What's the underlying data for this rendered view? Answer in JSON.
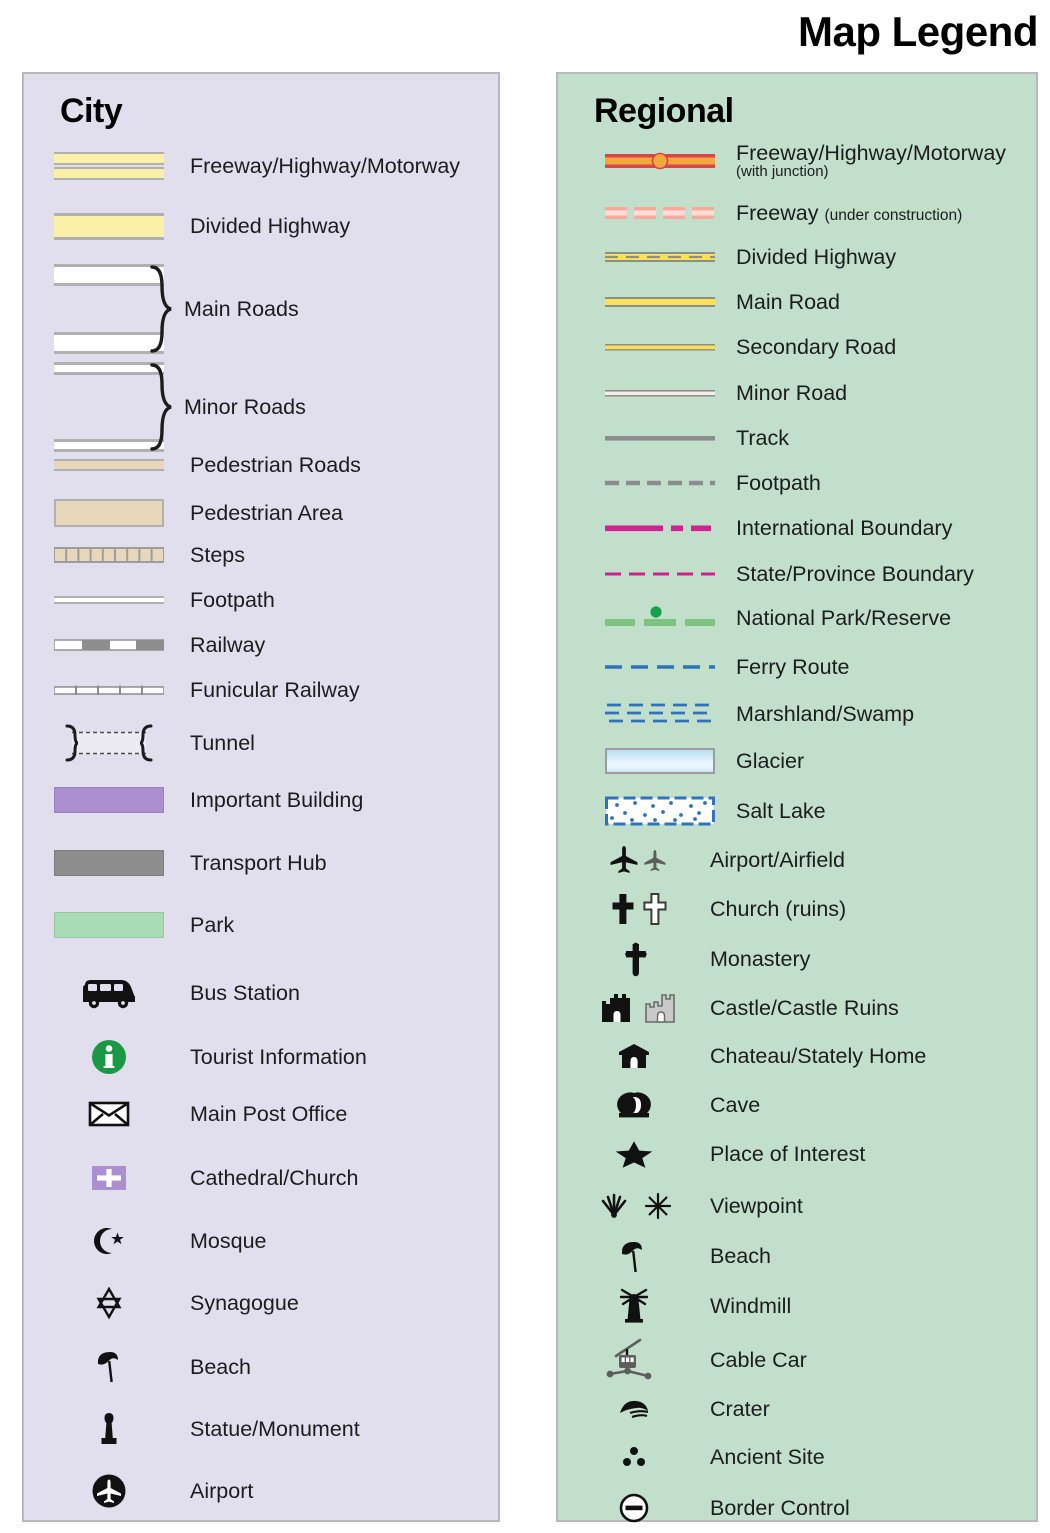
{
  "title": "Map Legend",
  "colors": {
    "city_panel_bg": "#e1deee",
    "regional_panel_bg": "#c2dfcb",
    "panel_border": "#b9b9bd",
    "highway_yellow": "#fbf0a8",
    "road_gray": "#b0b0b0",
    "pedestrian_tan": "#e8d8bb",
    "important_building_purple": "#ab8fd0",
    "transport_hub_gray": "#8d8d8d",
    "park_green": "#a9dcb4",
    "tourist_info_green": "#1a9944",
    "freeway_red": "#d9454a",
    "freeway_orange": "#f2a93c",
    "under_construction_pink": "#f8a99b",
    "regional_yellow": "#fbe255",
    "track_gray": "#8d8d8d",
    "boundary_magenta": "#cf2190",
    "national_park_green": "#7cc47f",
    "national_park_dot": "#16a04a",
    "ferry_blue": "#2f73bd",
    "glacier_blue": "#cfe6f7"
  },
  "city": {
    "heading": "City",
    "items": [
      {
        "label": "Freeway/Highway/Motorway",
        "icon": "freeway-band-symbol"
      },
      {
        "label": "Divided Highway",
        "icon": "divided-highway-symbol"
      },
      {
        "label": "Main Roads",
        "icon": "main-roads-symbol"
      },
      {
        "label": "Minor Roads",
        "icon": "minor-roads-symbol"
      },
      {
        "label": "Pedestrian Roads",
        "icon": "pedestrian-roads-symbol"
      },
      {
        "label": "Pedestrian Area",
        "icon": "pedestrian-area-symbol"
      },
      {
        "label": "Steps",
        "icon": "steps-symbol"
      },
      {
        "label": "Footpath",
        "icon": "footpath-symbol"
      },
      {
        "label": "Railway",
        "icon": "railway-symbol"
      },
      {
        "label": "Funicular Railway",
        "icon": "funicular-railway-symbol"
      },
      {
        "label": "Tunnel",
        "icon": "tunnel-symbol"
      },
      {
        "label": "Important Building",
        "icon": "important-building-swatch"
      },
      {
        "label": "Transport Hub",
        "icon": "transport-hub-swatch"
      },
      {
        "label": "Park",
        "icon": "park-swatch"
      },
      {
        "label": "Bus Station",
        "icon": "bus-icon"
      },
      {
        "label": "Tourist Information",
        "icon": "info-icon"
      },
      {
        "label": "Main Post Office",
        "icon": "envelope-icon"
      },
      {
        "label": "Cathedral/Church",
        "icon": "cross-square-icon"
      },
      {
        "label": "Mosque",
        "icon": "crescent-star-icon"
      },
      {
        "label": "Synagogue",
        "icon": "star-of-david-icon"
      },
      {
        "label": "Beach",
        "icon": "beach-umbrella-icon"
      },
      {
        "label": "Statue/Monument",
        "icon": "statue-icon"
      },
      {
        "label": "Airport",
        "icon": "airport-circle-icon"
      }
    ]
  },
  "regional": {
    "heading": "Regional",
    "items": [
      {
        "label": "Freeway/Highway/Motorway",
        "sublabel": "(with junction)",
        "icon": "freeway-junction-symbol"
      },
      {
        "label": "Freeway",
        "sublabel_inline": "(under construction)",
        "icon": "freeway-construction-symbol"
      },
      {
        "label": "Divided Highway",
        "icon": "divided-highway-symbol"
      },
      {
        "label": "Main Road",
        "icon": "main-road-symbol"
      },
      {
        "label": "Secondary Road",
        "icon": "secondary-road-symbol"
      },
      {
        "label": "Minor Road",
        "icon": "minor-road-symbol"
      },
      {
        "label": "Track",
        "icon": "track-symbol"
      },
      {
        "label": "Footpath",
        "icon": "footpath-dash-symbol"
      },
      {
        "label": "International Boundary",
        "icon": "international-boundary-symbol"
      },
      {
        "label": "State/Province Boundary",
        "icon": "state-boundary-symbol"
      },
      {
        "label": "National Park/Reserve",
        "icon": "national-park-symbol"
      },
      {
        "label": "Ferry Route",
        "icon": "ferry-route-symbol"
      },
      {
        "label": "Marshland/Swamp",
        "icon": "marshland-symbol"
      },
      {
        "label": "Glacier",
        "icon": "glacier-swatch"
      },
      {
        "label": "Salt Lake",
        "icon": "salt-lake-swatch"
      },
      {
        "label": "Airport/Airfield",
        "icon": "airplane-pair-icon"
      },
      {
        "label": "Church (ruins)",
        "icon": "cross-pair-icon"
      },
      {
        "label": "Monastery",
        "icon": "monastery-cross-icon"
      },
      {
        "label": "Castle/Castle Ruins",
        "icon": "castle-pair-icon"
      },
      {
        "label": "Chateau/Stately Home",
        "icon": "chateau-icon"
      },
      {
        "label": "Cave",
        "icon": "cave-icon"
      },
      {
        "label": "Place of Interest",
        "icon": "star-icon"
      },
      {
        "label": "Viewpoint",
        "icon": "viewpoint-pair-icon"
      },
      {
        "label": "Beach",
        "icon": "beach-umbrella-icon"
      },
      {
        "label": "Windmill",
        "icon": "windmill-icon"
      },
      {
        "label": "Cable Car",
        "icon": "cable-car-icon"
      },
      {
        "label": "Crater",
        "icon": "crater-icon"
      },
      {
        "label": "Ancient Site",
        "icon": "ancient-site-icon"
      },
      {
        "label": "Border Control",
        "icon": "border-control-icon"
      }
    ]
  }
}
